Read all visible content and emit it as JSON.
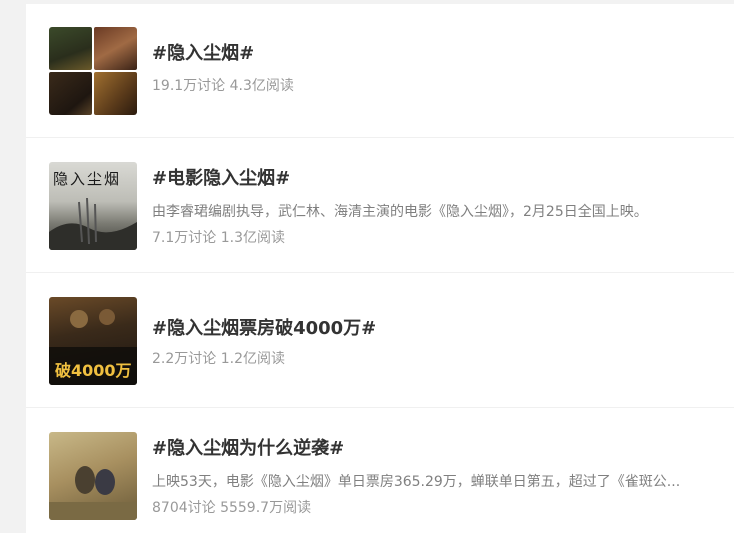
{
  "topics": [
    {
      "title": "#隐入尘烟#",
      "desc": "",
      "stats": "19.1万讨论 4.3亿阅读",
      "thumb_icon": "movie-collage-thumbnail"
    },
    {
      "title": "#电影隐入尘烟#",
      "desc": "由李睿珺编剧执导，武仁林、海清主演的电影《隐入尘烟》，2月25日全国上映。",
      "stats": "7.1万讨论 1.3亿阅读",
      "thumb_icon": "movie-poster-thumbnail",
      "thumb_text": "隐入尘烟"
    },
    {
      "title": "#隐入尘烟票房破4000万#",
      "desc": "",
      "stats": "2.2万讨论 1.2亿阅读",
      "thumb_icon": "box-office-poster-thumbnail",
      "thumb_text": "破4000万"
    },
    {
      "title": "#隐入尘烟为什么逆袭#",
      "desc": "上映53天，电影《隐入尘烟》单日票房365.29万，蝉联单日第五，超过了《雀斑公...",
      "stats": "8704讨论 5559.7万阅读",
      "thumb_icon": "film-still-thumbnail"
    }
  ]
}
